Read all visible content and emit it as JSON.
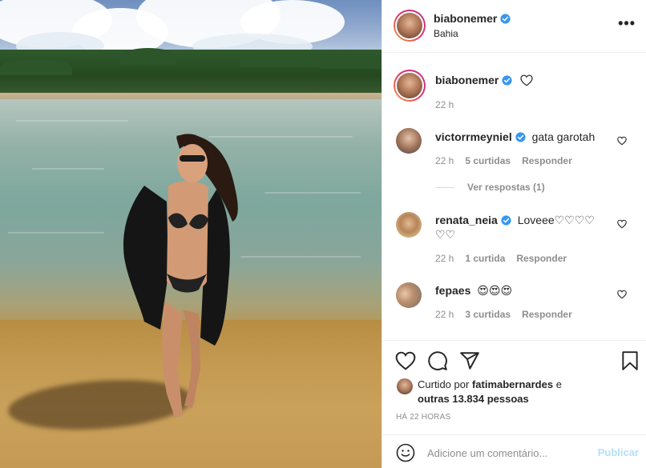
{
  "post": {
    "username": "biabonemer",
    "location": "Bahia",
    "caption_time": "22 h"
  },
  "comments": [
    {
      "username": "victorrmeyniel",
      "verified": true,
      "text": "gata garotah",
      "time": "22 h",
      "likes": "5 curtidas",
      "reply": "Responder",
      "view_replies": "Ver respostas (1)"
    },
    {
      "username": "renata_neia",
      "verified": true,
      "text": "Loveee♡♡♡♡",
      "text_line2": "♡♡",
      "time": "22 h",
      "likes": "1 curtida",
      "reply": "Responder"
    },
    {
      "username": "fepaes",
      "verified": false,
      "text": "😍😍😍",
      "time": "22 h",
      "likes": "3 curtidas",
      "reply": "Responder"
    }
  ],
  "likes": {
    "prefix": "Curtido por",
    "user": "fatimabernardes",
    "connector": "e",
    "others": "outras 13.834 pessoas"
  },
  "timestamp": "HÁ 22 HORAS",
  "composer": {
    "placeholder": "Adicione um comentário...",
    "publish_label": "Publicar"
  },
  "icons": [
    "verified-icon",
    "more-icon",
    "heart-icon",
    "comment-icon",
    "share-icon",
    "bookmark-icon",
    "emoji-icon"
  ],
  "colors": {
    "verified": "#3897f0",
    "publish_disabled": "#b2dffc",
    "muted": "#8e8e8e"
  }
}
